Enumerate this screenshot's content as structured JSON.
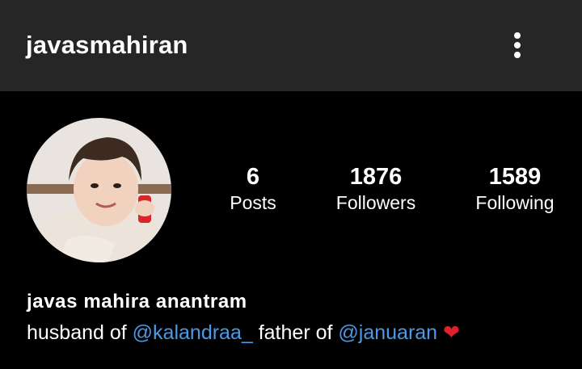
{
  "header": {
    "username": "javasmahiran",
    "more_icon": "more-vertical-icon"
  },
  "profile": {
    "avatar_icon": "profile-photo",
    "stats": [
      {
        "value": "6",
        "label": "Posts"
      },
      {
        "value": "1876",
        "label": "Followers"
      },
      {
        "value": "1589",
        "label": "Following"
      }
    ],
    "display_name": "javas mahira anantram",
    "bio": {
      "text1": "husband of ",
      "mention1": "@kalandraa_",
      "text2": " father of ",
      "mention2": "@januaran",
      "emoji": "❤"
    }
  },
  "colors": {
    "background": "#000000",
    "topbar": "#262626",
    "link": "#4a9ae6",
    "heart": "#e0202a"
  }
}
